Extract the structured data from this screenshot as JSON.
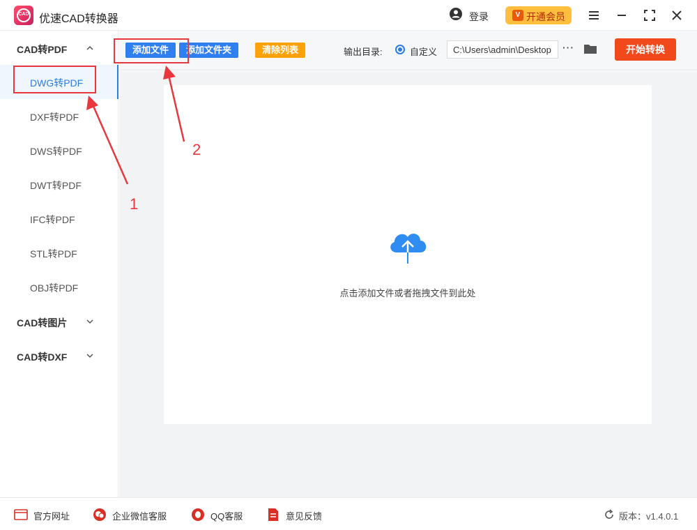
{
  "app": {
    "logo_text": "CAD",
    "title": "优速CAD转换器"
  },
  "header": {
    "login": "登录",
    "vip": "开通会员"
  },
  "sidebar": {
    "group_pdf": "CAD转PDF",
    "items": [
      "DWG转PDF",
      "DXF转PDF",
      "DWS转PDF",
      "DWT转PDF",
      "IFC转PDF",
      "STL转PDF",
      "OBJ转PDF"
    ],
    "group_img": "CAD转图片",
    "group_dxf": "CAD转DXF"
  },
  "toolbar": {
    "add_file": "添加文件",
    "add_folder": "添加文件夹",
    "clear_list": "清除列表",
    "output_label": "输出目录:",
    "custom": "自定义",
    "path": "C:\\Users\\admin\\Desktop",
    "start": "开始转换"
  },
  "main": {
    "drop_hint": "点击添加文件或者拖拽文件到此处"
  },
  "annotations": {
    "n1": "1",
    "n2": "2"
  },
  "footer": {
    "website": "官方网址",
    "wechat": "企业微信客服",
    "qq": "QQ客服",
    "feedback": "意见反馈",
    "version": "版本：v1.4.0.1"
  },
  "colors": {
    "accent": "#2b7ce0",
    "start": "#f2491c",
    "clear": "#ffa20a",
    "annotation": "#e8383d"
  }
}
